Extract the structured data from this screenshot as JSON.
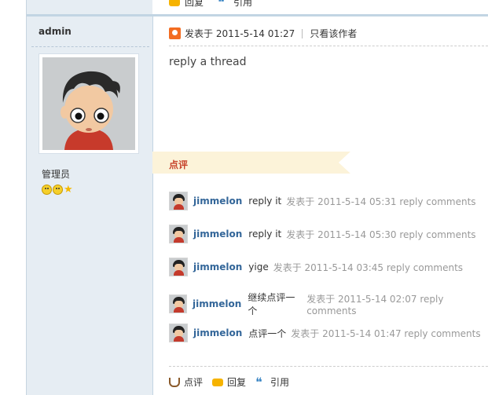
{
  "top_actions": {
    "reply_label": "回复",
    "quote_label": "引用"
  },
  "author": {
    "name": "admin",
    "role": "管理员"
  },
  "post": {
    "meta_posted": "发表于 2011-5-14 01:27",
    "meta_author_only": "只看该作者",
    "body": "reply a thread"
  },
  "comments_section": {
    "title": "点评",
    "items": [
      {
        "user": "jimmelon",
        "text": "reply it",
        "time": "发表于 2011-5-14 05:31 reply comments"
      },
      {
        "user": "jimmelon",
        "text": "reply it",
        "time": "发表于 2011-5-14 05:30 reply comments"
      },
      {
        "user": "jimmelon",
        "text": "yige",
        "time": "发表于 2011-5-14 03:45 reply comments"
      },
      {
        "user": "jimmelon",
        "text": "继续点评一个",
        "time": "发表于 2011-5-14 02:07 reply comments"
      },
      {
        "user": "jimmelon",
        "text": "点评一个",
        "time": "发表于 2011-5-14 01:47 reply comments"
      }
    ]
  },
  "bottom_actions": {
    "comment_label": "点评",
    "reply_label": "回复",
    "quote_label": "引用"
  },
  "colors": {
    "sidebar_bg": "#e6edf3",
    "username": "#336699",
    "comment_title": "#c7432b"
  }
}
